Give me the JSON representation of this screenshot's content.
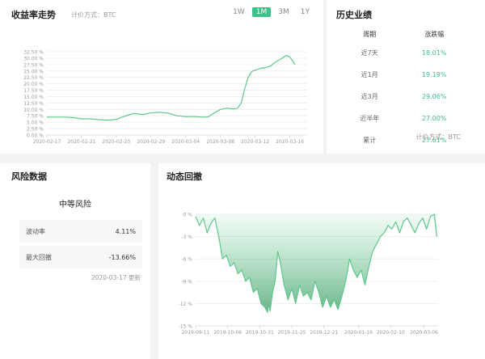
{
  "trend": {
    "title": "收益率走势",
    "pricing": "计价方式：BTC",
    "tabs": [
      "1W",
      "1M",
      "3M",
      "1Y"
    ],
    "active_tab": "1M"
  },
  "history": {
    "title": "历史业绩",
    "col_period": "周期",
    "col_change": "涨跌幅",
    "rows": [
      {
        "period": "近7天",
        "change": "18.01%"
      },
      {
        "period": "近1月",
        "change": "19.19%"
      },
      {
        "period": "近3月",
        "change": "29.06%"
      },
      {
        "period": "近半年",
        "change": "27.00%"
      },
      {
        "period": "累计",
        "change": "27.61%"
      }
    ],
    "pricing": "计价方式：BTC"
  },
  "risk": {
    "title": "风险数据",
    "level": "中等风险",
    "volatility_label": "波动率",
    "volatility_value": "4.11%",
    "drawdown_label": "最大回撤",
    "drawdown_value": "-13.66%",
    "updated": "2020-03-17 更新"
  },
  "drawdown": {
    "title": "动态回撤"
  },
  "colors": {
    "accent": "#3cc28a",
    "line": "#5cc98a",
    "fill_top": "#3a9a62"
  },
  "chart_data": [
    {
      "type": "line",
      "name": "return-trend",
      "yticks": [
        "0.00 %",
        "2.50 %",
        "5.00 %",
        "7.50 %",
        "10.00 %",
        "12.50 %",
        "15.00 %",
        "17.50 %",
        "20.00 %",
        "22.50 %",
        "25.00 %",
        "27.50 %",
        "30.00 %",
        "32.50 %"
      ],
      "ylim": [
        0,
        32.5
      ],
      "xlim": [
        0,
        30
      ],
      "xticks": [
        {
          "d": 0,
          "label": "2020-02-17"
        },
        {
          "d": 4,
          "label": "2020-02-21"
        },
        {
          "d": 8,
          "label": "2020-02-25"
        },
        {
          "d": 12,
          "label": "2020-02-29"
        },
        {
          "d": 16,
          "label": "2020-03-04"
        },
        {
          "d": 20,
          "label": "2020-03-08"
        },
        {
          "d": 24,
          "label": "2020-03-12"
        },
        {
          "d": 28,
          "label": "2020-03-16"
        }
      ],
      "grid": "horizontal",
      "x": [
        0,
        1,
        2,
        3,
        4,
        5,
        6,
        7,
        8,
        9,
        10,
        11,
        12,
        13,
        14,
        15,
        16,
        17,
        18,
        18.6,
        19,
        20,
        20.8,
        21.2,
        21.6,
        22,
        22.4,
        22.8,
        23.2,
        23.6,
        24,
        24.6,
        25.2,
        25.8,
        26.4,
        27,
        27.6,
        28,
        28.3,
        28.6
      ],
      "y": [
        7.0,
        7.0,
        7.0,
        6.8,
        6.3,
        6.3,
        6.0,
        5.8,
        6.1,
        7.4,
        8.4,
        8.0,
        8.6,
        8.9,
        8.5,
        7.5,
        7.2,
        7.2,
        7.0,
        7.1,
        8.0,
        10.0,
        10.5,
        10.3,
        10.2,
        10.5,
        12.5,
        18.0,
        22.5,
        24.8,
        25.3,
        26.0,
        26.3,
        27.0,
        28.6,
        29.7,
        31.1,
        30.5,
        29.0,
        27.5
      ]
    },
    {
      "type": "area",
      "name": "dynamic-drawdown",
      "yticks": [
        "0 %",
        "-3 %",
        "-6 %",
        "-9 %",
        "-12 %",
        "-15 %"
      ],
      "ylim": [
        -15,
        0
      ],
      "xlim": [
        0,
        189
      ],
      "xticks": [
        {
          "d": 0,
          "label": "2019-09-11"
        },
        {
          "d": 25,
          "label": "2019-10-06"
        },
        {
          "d": 50,
          "label": "2019-10-31"
        },
        {
          "d": 75,
          "label": "2019-11-25"
        },
        {
          "d": 100,
          "label": "2019-12-21"
        },
        {
          "d": 127,
          "label": "2020-01-16"
        },
        {
          "d": 152,
          "label": "2020-02-10"
        },
        {
          "d": 178,
          "label": "2020-03-06"
        }
      ],
      "grid": "horizontal",
      "x": [
        0,
        3,
        6,
        9,
        12,
        15,
        18,
        21,
        24,
        27,
        30,
        33,
        36,
        39,
        42,
        45,
        48,
        51,
        54,
        56,
        57,
        58,
        60,
        62,
        63,
        64,
        66,
        69,
        72,
        75,
        78,
        81,
        84,
        87,
        90,
        93,
        96,
        99,
        102,
        105,
        108,
        111,
        114,
        117,
        120,
        123,
        126,
        129,
        132,
        135,
        138,
        141,
        144,
        147,
        150,
        153,
        156,
        159,
        162,
        165,
        168,
        171,
        174,
        177,
        180,
        183,
        186,
        188
      ],
      "y": [
        -0.3,
        -1.5,
        -0.5,
        -2.5,
        -1.2,
        -0.5,
        -3.0,
        -6.0,
        -5.5,
        -7.0,
        -6.5,
        -8.0,
        -7.5,
        -9.0,
        -8.5,
        -10.5,
        -10.0,
        -12.0,
        -12.5,
        -13.2,
        -12.0,
        -13.0,
        -10.5,
        -9.0,
        -7.0,
        -5.0,
        -6.5,
        -9.5,
        -11.5,
        -10.0,
        -12.0,
        -9.5,
        -11.0,
        -10.5,
        -11.5,
        -9.0,
        -10.5,
        -12.5,
        -11.0,
        -12.5,
        -11.5,
        -12.8,
        -11.0,
        -9.0,
        -6.0,
        -7.5,
        -8.5,
        -7.5,
        -9.5,
        -7.0,
        -5.0,
        -4.0,
        -3.0,
        -2.5,
        -1.5,
        -2.0,
        -1.0,
        -2.5,
        -1.0,
        -0.5,
        -1.5,
        -2.5,
        -1.2,
        -0.5,
        -2.0,
        -0.3,
        0.0,
        -3.0
      ]
    }
  ]
}
